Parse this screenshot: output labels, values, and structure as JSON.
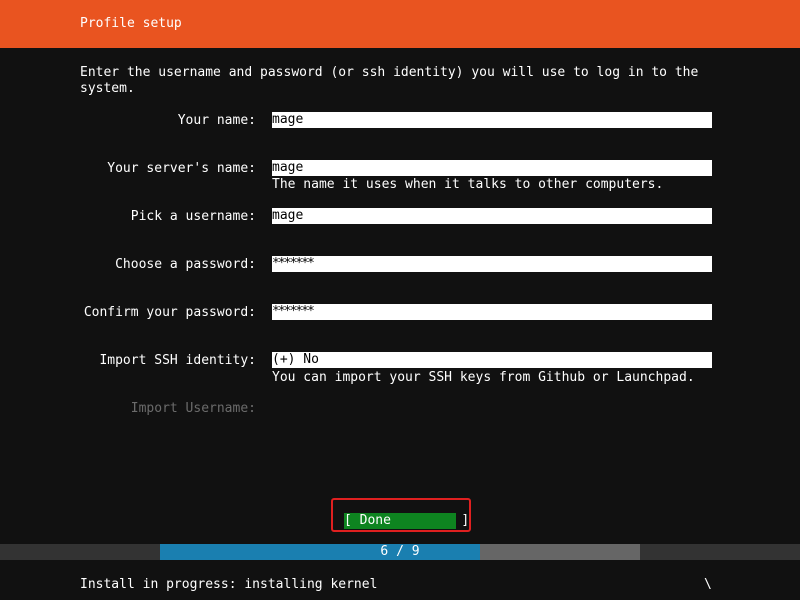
{
  "header": {
    "title": "Profile setup",
    "color": "#e95420"
  },
  "intro": "Enter the username and password (or ssh identity) you will use to log in to the\nsystem.",
  "form": {
    "your_name": {
      "label": "Your name:",
      "value": "mage"
    },
    "server_name": {
      "label": "Your server's name:",
      "value": "mage",
      "hint": "The name it uses when it talks to other computers."
    },
    "username": {
      "label": "Pick a username:",
      "value": "mage"
    },
    "password": {
      "label": "Choose a password:",
      "value": "*******"
    },
    "confirm_password": {
      "label": "Confirm your password:",
      "value": "*******"
    },
    "import_ssh": {
      "label": "Import SSH identity:",
      "value": "(+) No",
      "hint": "You can import your SSH keys from Github or Launchpad."
    },
    "import_username": {
      "label": "Import Username:"
    }
  },
  "done_button": {
    "label": "[ Done         ]",
    "color": "#0e8420"
  },
  "progress": {
    "text": "6 / 9",
    "current": 6,
    "total": 9
  },
  "status": {
    "text": "Install in progress: installing kernel",
    "spinner": "\\"
  }
}
